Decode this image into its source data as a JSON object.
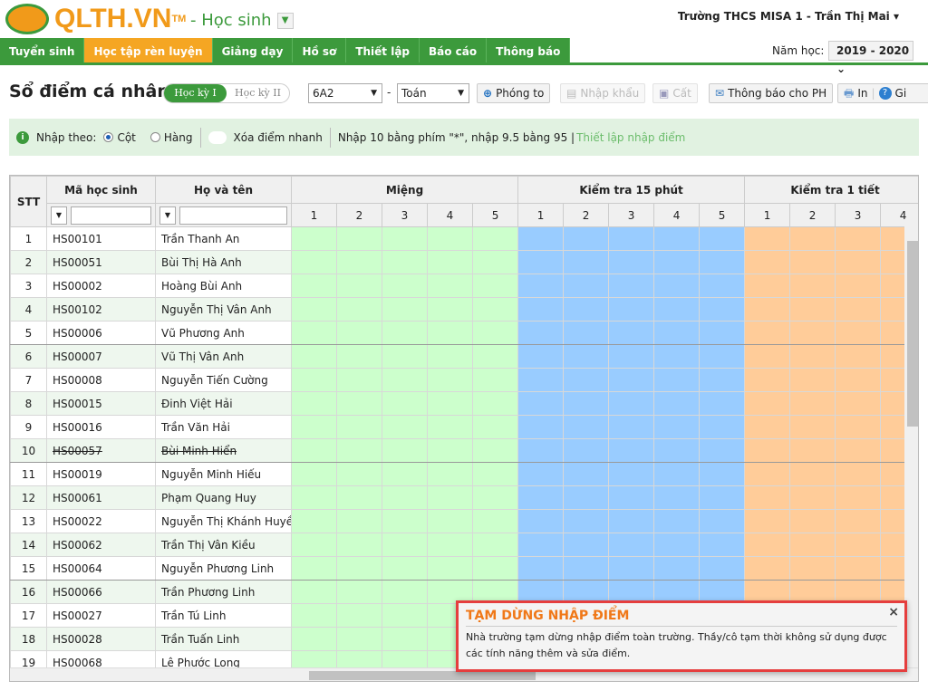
{
  "header": {
    "logo": "QLTH.VN",
    "tm": "TM",
    "role": "- Học sinh",
    "user": "Trường THCS MISA 1 - Trần Thị Mai"
  },
  "nav": [
    "Tuyển sinh",
    "Học tập rèn luyện",
    "Giảng dạy",
    "Hồ sơ",
    "Thiết lập",
    "Báo cáo",
    "Thông báo"
  ],
  "year": {
    "label": "Năm học:",
    "value": "2019 - 2020"
  },
  "page": {
    "title": "Sổ điểm cá nhân",
    "sem1": "Học kỳ I",
    "sem2": "Học kỳ II",
    "class": "6A2",
    "dash": "-",
    "subject": "Toán"
  },
  "toolbar": {
    "zoom": "Phóng to",
    "import": "Nhập khẩu",
    "save": "Cất",
    "notify": "Thông báo cho PH",
    "print": "In",
    "help": "Gi"
  },
  "info": {
    "by": "Nhập theo:",
    "col": "Cột",
    "row": "Hàng",
    "quick_delete": "Xóa điểm nhanh",
    "hint": "Nhập 10 bằng phím \"*\", nhập 9.5 bằng 95 |",
    "setup_link": "Thiết lập nhập điểm"
  },
  "grid": {
    "stt": "STT",
    "code": "Mã học sinh",
    "name": "Họ và tên",
    "groups": [
      "Miệng",
      "Kiểm tra 15 phút",
      "Kiểm tra 1 tiết"
    ],
    "rows": [
      [
        "1",
        "HS00101",
        "Trần Thanh An"
      ],
      [
        "2",
        "HS00051",
        "Bùi Thị Hà Anh"
      ],
      [
        "3",
        "HS00002",
        "Hoàng Bùi Anh"
      ],
      [
        "4",
        "HS00102",
        "Nguyễn Thị Vân Anh"
      ],
      [
        "5",
        "HS00006",
        "Vũ Phương Anh"
      ],
      [
        "6",
        "HS00007",
        "Vũ Thị Vân Anh"
      ],
      [
        "7",
        "HS00008",
        "Nguyễn Tiến Cường"
      ],
      [
        "8",
        "HS00015",
        "Đinh Việt Hải"
      ],
      [
        "9",
        "HS00016",
        "Trần Văn Hải"
      ],
      [
        "10",
        "HS00057",
        "Bùi Minh Hiển"
      ],
      [
        "11",
        "HS00019",
        "Nguyễn Minh Hiếu"
      ],
      [
        "12",
        "HS00061",
        "Phạm Quang Huy"
      ],
      [
        "13",
        "HS00022",
        "Nguyễn Thị Khánh Huyền"
      ],
      [
        "14",
        "HS00062",
        "Trần Thị Vân Kiều"
      ],
      [
        "15",
        "HS00064",
        "Nguyễn Phương Linh"
      ],
      [
        "16",
        "HS00066",
        "Trần Phương Linh"
      ],
      [
        "17",
        "HS00027",
        "Trần Tú Linh"
      ],
      [
        "18",
        "HS00028",
        "Trần Tuấn Linh"
      ],
      [
        "19",
        "HS00068",
        "Lê Phước Long"
      ]
    ],
    "struck_row": "10"
  },
  "popup": {
    "title": "TẠM DỪNG NHẬP ĐIỂM",
    "body": "Nhà trường tạm dừng nhập điểm toàn trường. Thầy/cô tạm thời không sử dụng được các tính năng thêm và sửa điểm.",
    "close": "×"
  }
}
